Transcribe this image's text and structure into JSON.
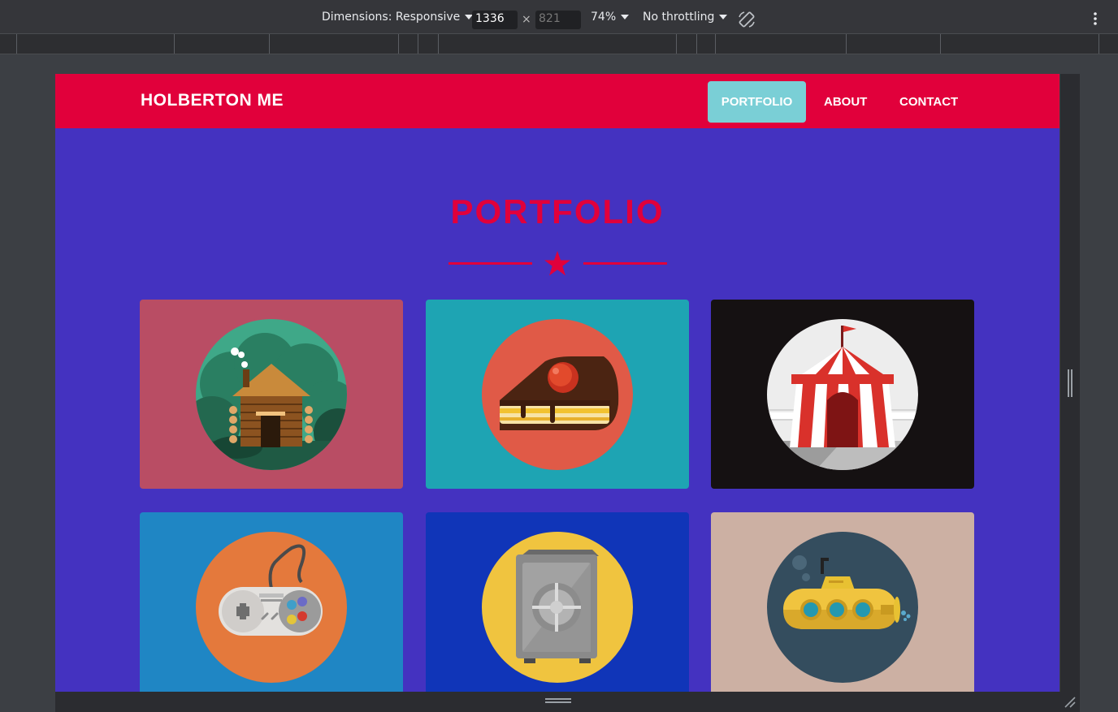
{
  "devtools": {
    "dimensions_label": "Dimensions: Responsive",
    "width_value": "1336",
    "height_value": "821",
    "times_sign": "×",
    "zoom": "74%",
    "throttling": "No throttling"
  },
  "site": {
    "brand": "HOLBERTON ME",
    "nav": {
      "portfolio": "PORTFOLIO",
      "about": "ABOUT",
      "contact": "CONTACT"
    },
    "section_title": "PORTFOLIO",
    "colors": {
      "header": "#e1003b",
      "page_background": "#4432c0",
      "nav_active": "#7acfd6"
    },
    "cards": [
      {
        "icon": "log-cabin-icon",
        "background": "#b94d64"
      },
      {
        "icon": "cake-slice-icon",
        "background": "#1ea4b3"
      },
      {
        "icon": "circus-tent-icon",
        "background": "#151112"
      },
      {
        "icon": "game-controller-icon",
        "background": "#1f86c4"
      },
      {
        "icon": "safe-icon",
        "background": "#1035b8"
      },
      {
        "icon": "submarine-icon",
        "background": "#ccb0a3"
      }
    ]
  }
}
